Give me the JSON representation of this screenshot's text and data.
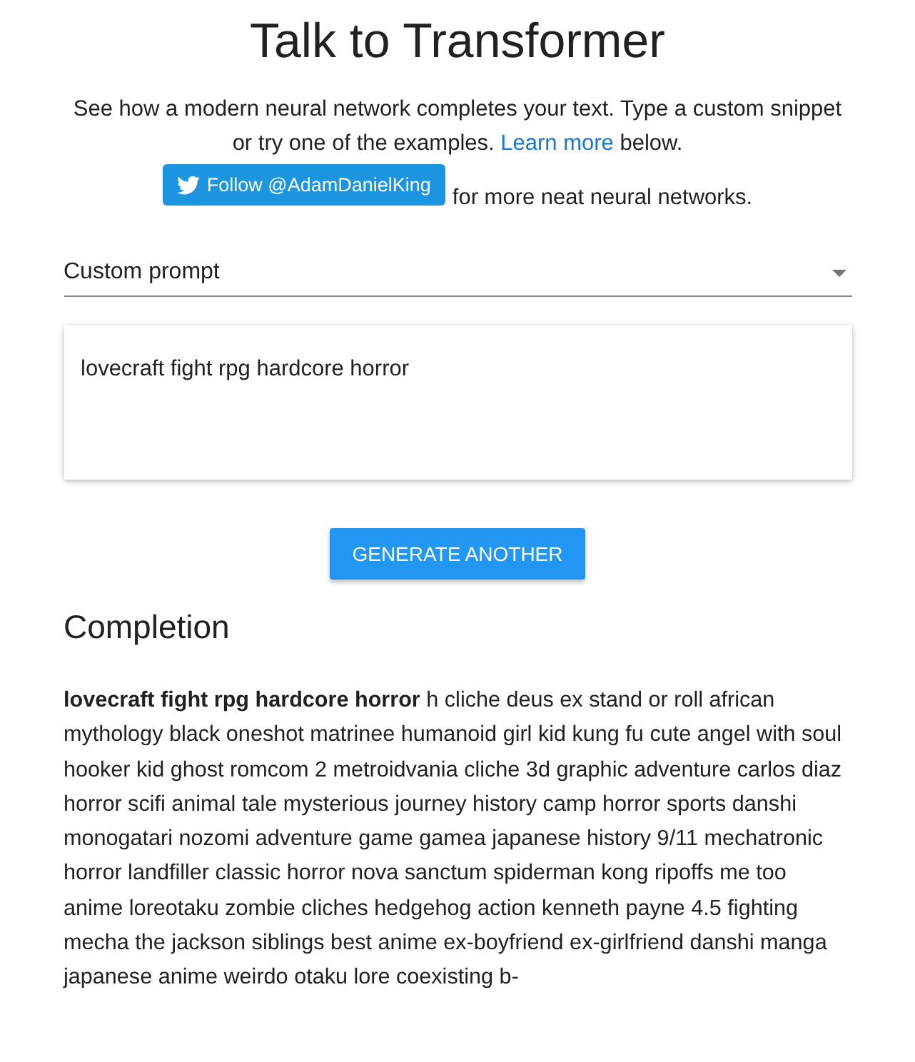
{
  "title": "Talk to Transformer",
  "intro": {
    "before": "See how a modern neural network completes your text. Type a custom snippet or try one of the examples.",
    "link": "Learn more",
    "after": "below."
  },
  "follow": {
    "button": "Follow @AdamDanielKing",
    "text": "for more neat neural networks."
  },
  "prompt_select": {
    "value": "Custom prompt"
  },
  "prompt_field": {
    "value": "lovecraft fight rpg hardcore horror"
  },
  "generate_button": "GENERATE ANOTHER",
  "completion": {
    "heading": "Completion",
    "text": "**lovecraft fight rpg hardcore horror** h cliche deus ex stand or roll african mythology black oneshot matrinee humanoid girl kid kung fu cute angel with soul hooker kid ghost romcom 2 metroidvania cliche 3d graphic adventure carlos diaz horror scifi animal tale mysterious journey history camp horror sports danshi monogatari nozomi adventure game gamea japanese history 9/11 mechatronic horror landfiller classic horror nova sanctum spiderman kong ripoffs me too anime loreotaku zombie cliches hedgehog action kenneth payne 4.5 fighting mecha the jackson siblings best anime ex-boyfriend ex-girlfriend danshi manga japanese anime weirdo otaku lore coexisting b-"
  }
}
